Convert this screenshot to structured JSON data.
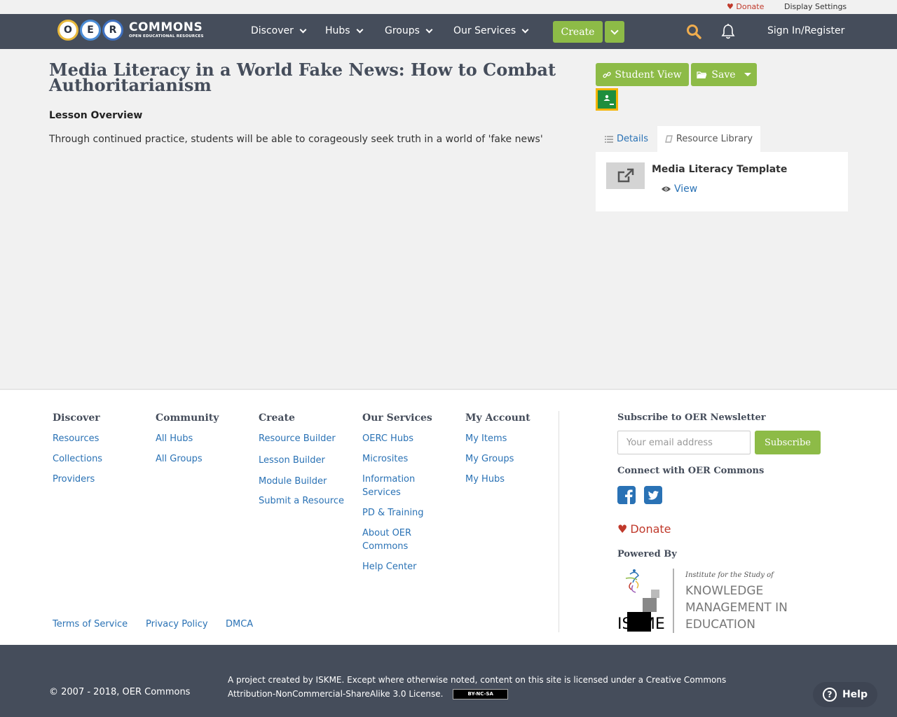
{
  "util_bar": {
    "donate": "Donate",
    "display_settings": "Display Settings"
  },
  "header": {
    "logo_letters": [
      "O",
      "E",
      "R"
    ],
    "logo_word": "COMMONS",
    "logo_tagline": "OPEN EDUCATIONAL RESOURCES",
    "nav": [
      "Discover",
      "Hubs",
      "Groups",
      "Our Services"
    ],
    "create_label": "Create",
    "sign_in": "Sign In/Register"
  },
  "main": {
    "title": "Media Literacy in a World Fake News: How to Combat Authoritarianism",
    "overview_heading": "Lesson Overview",
    "overview_text": "Through continued practice, students will be able to corageously seek truth in a world of 'fake news'",
    "student_view": "Student View",
    "save": "Save",
    "tabs": {
      "details": "Details",
      "resource_library": "Resource Library"
    },
    "library_item": {
      "title": "Media Literacy Template",
      "view": "View"
    }
  },
  "footer": {
    "columns": [
      {
        "heading": "Discover",
        "links": [
          "Resources",
          "Collections",
          "Providers"
        ]
      },
      {
        "heading": "Community",
        "links": [
          "All Hubs",
          "All Groups"
        ]
      },
      {
        "heading": "Create",
        "links": [
          "Resource Builder",
          "Lesson Builder",
          "Module Builder",
          "Submit a Resource"
        ]
      },
      {
        "heading": "Our Services",
        "links": [
          "OERC Hubs",
          "Microsites",
          "Information Services",
          "PD & Training",
          "About OER Commons",
          "Help Center"
        ]
      },
      {
        "heading": "My Account",
        "links": [
          "My Items",
          "My Groups",
          "My Hubs"
        ]
      }
    ],
    "legal": [
      "Terms of Service",
      "Privacy Policy",
      "DMCA"
    ],
    "newsletter_heading": "Subscribe to OER Newsletter",
    "email_placeholder": "Your email address",
    "subscribe": "Subscribe",
    "connect_heading": "Connect with OER Commons",
    "donate": "Donate",
    "powered_by": "Powered By",
    "iskme": {
      "tagline": "Institute for the Study of",
      "line1": "KNOWLEDGE",
      "line2": "MANAGEMENT IN",
      "line3": "EDUCATION",
      "mark": "ISKME"
    }
  },
  "bottom": {
    "copyright": "© 2007 - 2018, OER Commons",
    "license": "A project created by ISKME. Except where otherwise noted, content on this site is licensed under a Creative Commons Attribution-NonCommercial-ShareAlike 3.0 License.",
    "cc_badge": "BY-NC-SA",
    "help": "Help"
  },
  "colors": {
    "header_bg": "#454d5b",
    "accent_green": "#8dbb47",
    "link_blue": "#2a72b5",
    "donate_red": "#c0392b",
    "search_orange": "#f0ad4e"
  },
  "icons": [
    "heart-icon",
    "search-icon",
    "bell-icon",
    "link-icon",
    "folder-icon",
    "google-classroom-icon",
    "list-icon",
    "book-icon",
    "external-link-icon",
    "eye-icon",
    "facebook-icon",
    "twitter-icon",
    "help-icon"
  ]
}
